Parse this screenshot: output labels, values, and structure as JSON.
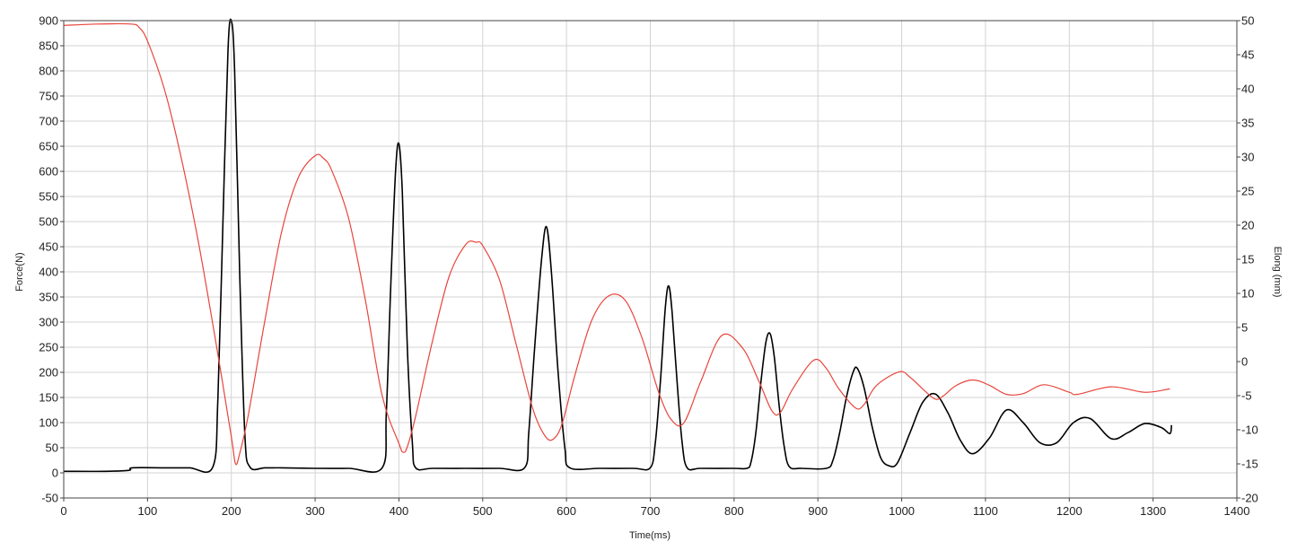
{
  "chart_data": {
    "type": "line",
    "title": "",
    "xlabel": "Time(ms)",
    "ylabel_left": "Force(N)",
    "ylabel_right": "Elong (mm)",
    "xlim": [
      0,
      1400
    ],
    "ylim_left": [
      -50,
      900
    ],
    "ylim_right": [
      -20,
      50
    ],
    "x_ticks": [
      0,
      100,
      200,
      300,
      400,
      500,
      600,
      700,
      800,
      900,
      1000,
      1100,
      1200,
      1300,
      1400
    ],
    "y_left_ticks": [
      -50,
      0,
      50,
      100,
      150,
      200,
      250,
      300,
      350,
      400,
      450,
      500,
      550,
      600,
      650,
      700,
      750,
      800,
      850,
      900
    ],
    "y_right_ticks": [
      -20,
      -15,
      -10,
      -5,
      0,
      5,
      10,
      15,
      20,
      25,
      30,
      35,
      40,
      45,
      50
    ],
    "grid": true,
    "series": [
      {
        "axis": "left",
        "color": "#000000",
        "x": [
          0,
          50,
          78,
          82,
          120,
          150,
          178,
          184,
          190,
          196,
          200,
          204,
          210,
          216,
          222,
          240,
          260,
          300,
          340,
          380,
          385,
          390,
          396,
          400,
          404,
          410,
          416,
          420,
          440,
          480,
          520,
          550,
          555,
          562,
          570,
          576,
          582,
          590,
          598,
          604,
          640,
          680,
          700,
          706,
          712,
          718,
          722,
          726,
          732,
          738,
          744,
          760,
          800,
          815,
          820,
          826,
          832,
          838,
          843,
          848,
          854,
          860,
          866,
          880,
          910,
          918,
          926,
          934,
          942,
          947,
          955,
          965,
          975,
          985,
          995,
          1010,
          1025,
          1040,
          1055,
          1070,
          1085,
          1105,
          1125,
          1145,
          1165,
          1185,
          1205,
          1225,
          1250,
          1270,
          1290,
          1310,
          1320,
          1322
        ],
        "y": [
          3,
          3,
          5,
          10,
          10,
          10,
          12,
          150,
          500,
          840,
          900,
          800,
          400,
          80,
          12,
          10,
          10,
          9,
          9,
          10,
          120,
          360,
          600,
          655,
          560,
          250,
          60,
          10,
          9,
          9,
          9,
          10,
          80,
          250,
          420,
          490,
          400,
          200,
          50,
          10,
          9,
          9,
          10,
          60,
          180,
          330,
          372,
          320,
          180,
          60,
          10,
          9,
          9,
          9,
          20,
          80,
          180,
          260,
          277,
          230,
          130,
          50,
          12,
          9,
          9,
          25,
          80,
          150,
          200,
          208,
          170,
          90,
          30,
          14,
          20,
          80,
          140,
          157,
          120,
          65,
          38,
          70,
          125,
          100,
          60,
          60,
          100,
          108,
          68,
          80,
          98,
          90,
          78,
          95
        ]
      },
      {
        "axis": "right",
        "color": "#e8453c",
        "x": [
          0,
          40,
          80,
          90,
          100,
          120,
          140,
          160,
          180,
          200,
          205,
          210,
          220,
          240,
          260,
          280,
          300,
          310,
          320,
          340,
          360,
          380,
          400,
          405,
          410,
          420,
          440,
          460,
          480,
          492,
          500,
          520,
          540,
          560,
          575,
          585,
          595,
          610,
          630,
          650,
          670,
          690,
          710,
          725,
          740,
          760,
          785,
          810,
          830,
          845,
          855,
          870,
          895,
          910,
          925,
          945,
          955,
          970,
          997,
          1010,
          1025,
          1040,
          1050,
          1065,
          1085,
          1105,
          1125,
          1145,
          1170,
          1200,
          1210,
          1250,
          1290,
          1320
        ],
        "y": [
          49.3,
          49.5,
          49.5,
          49.0,
          47.0,
          40.0,
          30.0,
          18.0,
          4.0,
          -11.0,
          -15.0,
          -13.5,
          -8.0,
          6.0,
          19.0,
          27.0,
          30.2,
          29.8,
          28.0,
          21.0,
          9.0,
          -5.0,
          -12.0,
          -13.3,
          -12.5,
          -8.0,
          3.0,
          12.5,
          17.2,
          17.5,
          17.0,
          12.0,
          2.5,
          -7.0,
          -11.0,
          -11.3,
          -9.0,
          -2.0,
          6.0,
          9.6,
          9.0,
          3.5,
          -4.5,
          -8.5,
          -9.0,
          -3.0,
          3.8,
          2.0,
          -3.0,
          -7.2,
          -7.5,
          -4.0,
          0.2,
          -1.0,
          -4.0,
          -6.8,
          -6.3,
          -3.5,
          -1.5,
          -2.3,
          -4.0,
          -5.5,
          -5.0,
          -3.5,
          -2.7,
          -3.5,
          -4.8,
          -4.7,
          -3.4,
          -4.5,
          -4.8,
          -3.7,
          -4.5,
          -4.0
        ]
      }
    ]
  }
}
